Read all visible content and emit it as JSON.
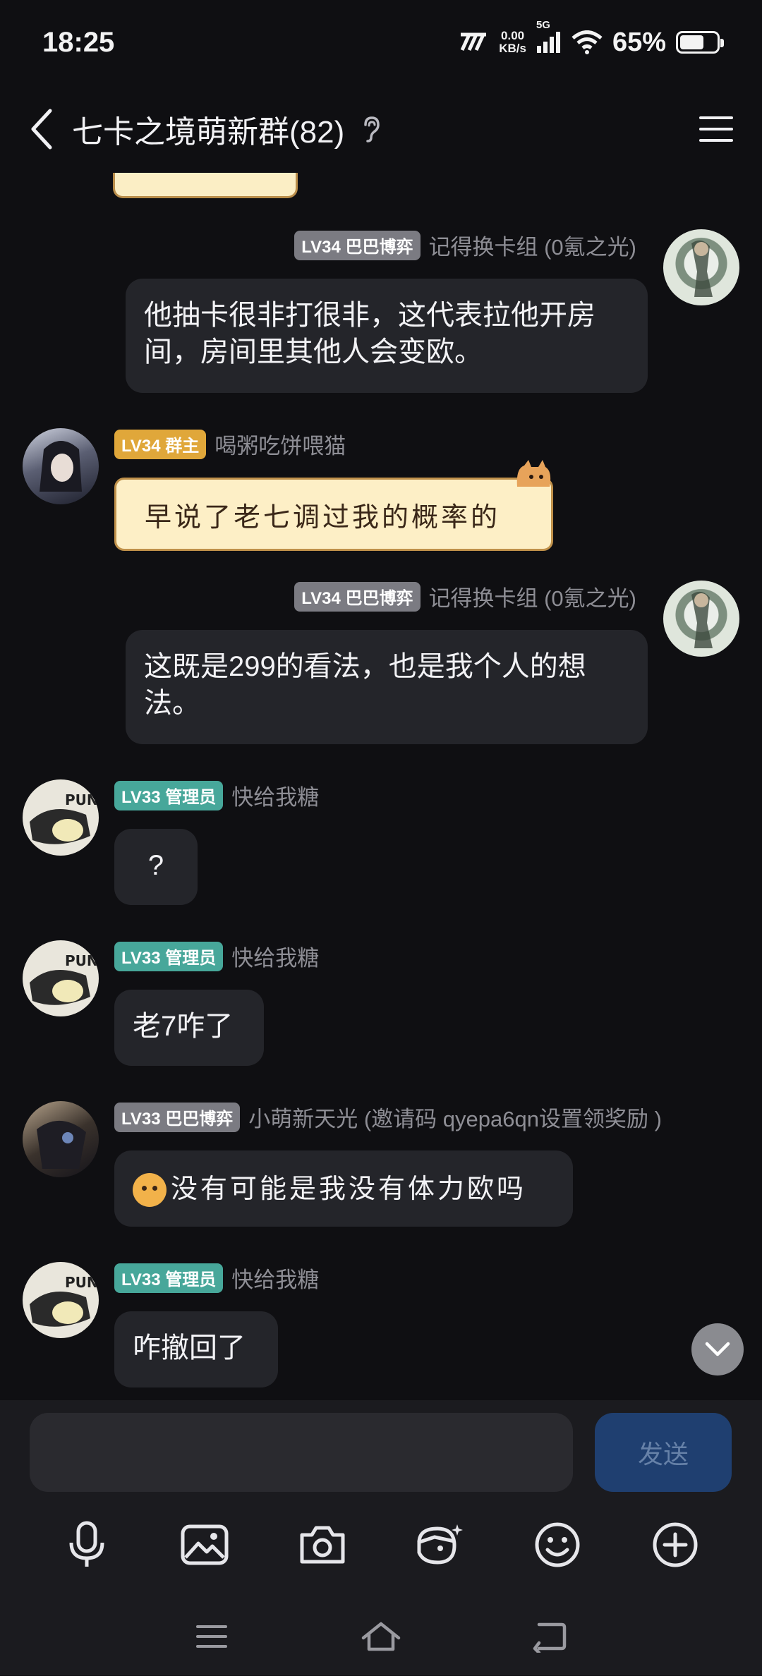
{
  "status_bar": {
    "time": "18:25",
    "net_speed_value": "0.00",
    "net_speed_unit": "KB/s",
    "signal_label": "5G",
    "battery_percent": "65%",
    "battery_level": 0.65
  },
  "header": {
    "title": "七卡之境萌新群(82)"
  },
  "messages": [
    {
      "side": "right",
      "badge": "LV34 巴巴博弈",
      "badge_color": "gray",
      "nickname": "记得换卡组 (0氪之光)",
      "text": "他抽卡很非打很非，这代表拉他开房间，房间里其他人会变欧。"
    },
    {
      "side": "left",
      "badge": "LV34 群主",
      "badge_color": "gold",
      "nickname": "喝粥吃饼喂猫",
      "sticker_text": "早说了老七调过我的概率的"
    },
    {
      "side": "right",
      "badge": "LV34 巴巴博弈",
      "badge_color": "gray",
      "nickname": "记得换卡组 (0氪之光)",
      "text": "这既是299的看法，也是我个人的想法。"
    },
    {
      "side": "left",
      "badge": "LV33 管理员",
      "badge_color": "teal",
      "nickname": "快给我糖",
      "text": "?"
    },
    {
      "side": "left",
      "badge": "LV33 管理员",
      "badge_color": "teal",
      "nickname": "快给我糖",
      "text": "老7咋了"
    },
    {
      "side": "left",
      "badge": "LV33 巴巴博弈",
      "badge_color": "gray",
      "nickname": "小萌新天光 (邀请码 qyepa6qn设置领奖励 )",
      "text": "没有可能是我没有体力欧吗"
    },
    {
      "side": "left",
      "badge": "LV33 管理员",
      "badge_color": "teal",
      "nickname": "快给我糖",
      "text": "咋撤回了"
    }
  ],
  "input": {
    "value": "",
    "send_label": "发送"
  },
  "colors": {
    "background": "#0f0f12",
    "bubble": "#24252a",
    "send_button": "#1f3f70",
    "badge_gray": "#7b7b82",
    "badge_gold": "#e0a73a",
    "badge_teal": "#47a79a"
  },
  "icons": {
    "back": "back-chevron-icon",
    "ear": "ear-icon",
    "menu": "menu-icon",
    "toolbar": [
      "microphone-icon",
      "image-icon",
      "camera-icon",
      "ai-face-icon",
      "emoji-icon",
      "plus-icon"
    ],
    "nav": [
      "recent-apps-icon",
      "home-icon",
      "back-nav-icon"
    ]
  }
}
